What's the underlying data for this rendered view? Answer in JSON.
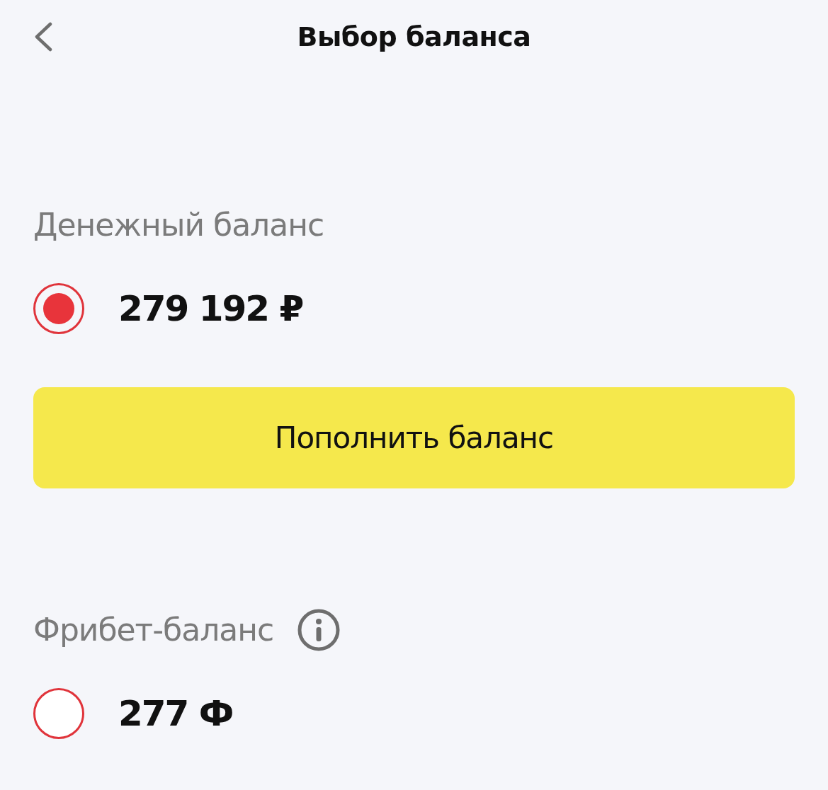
{
  "header": {
    "title": "Выбор баланса"
  },
  "balances": [
    {
      "label": "Денежный баланс",
      "info": false,
      "amount": "279 192 ₽",
      "selected": true,
      "action": "Пополнить баланс"
    },
    {
      "label": "Фрибет-баланс",
      "info": true,
      "amount": "277 Ф",
      "selected": false
    }
  ]
}
